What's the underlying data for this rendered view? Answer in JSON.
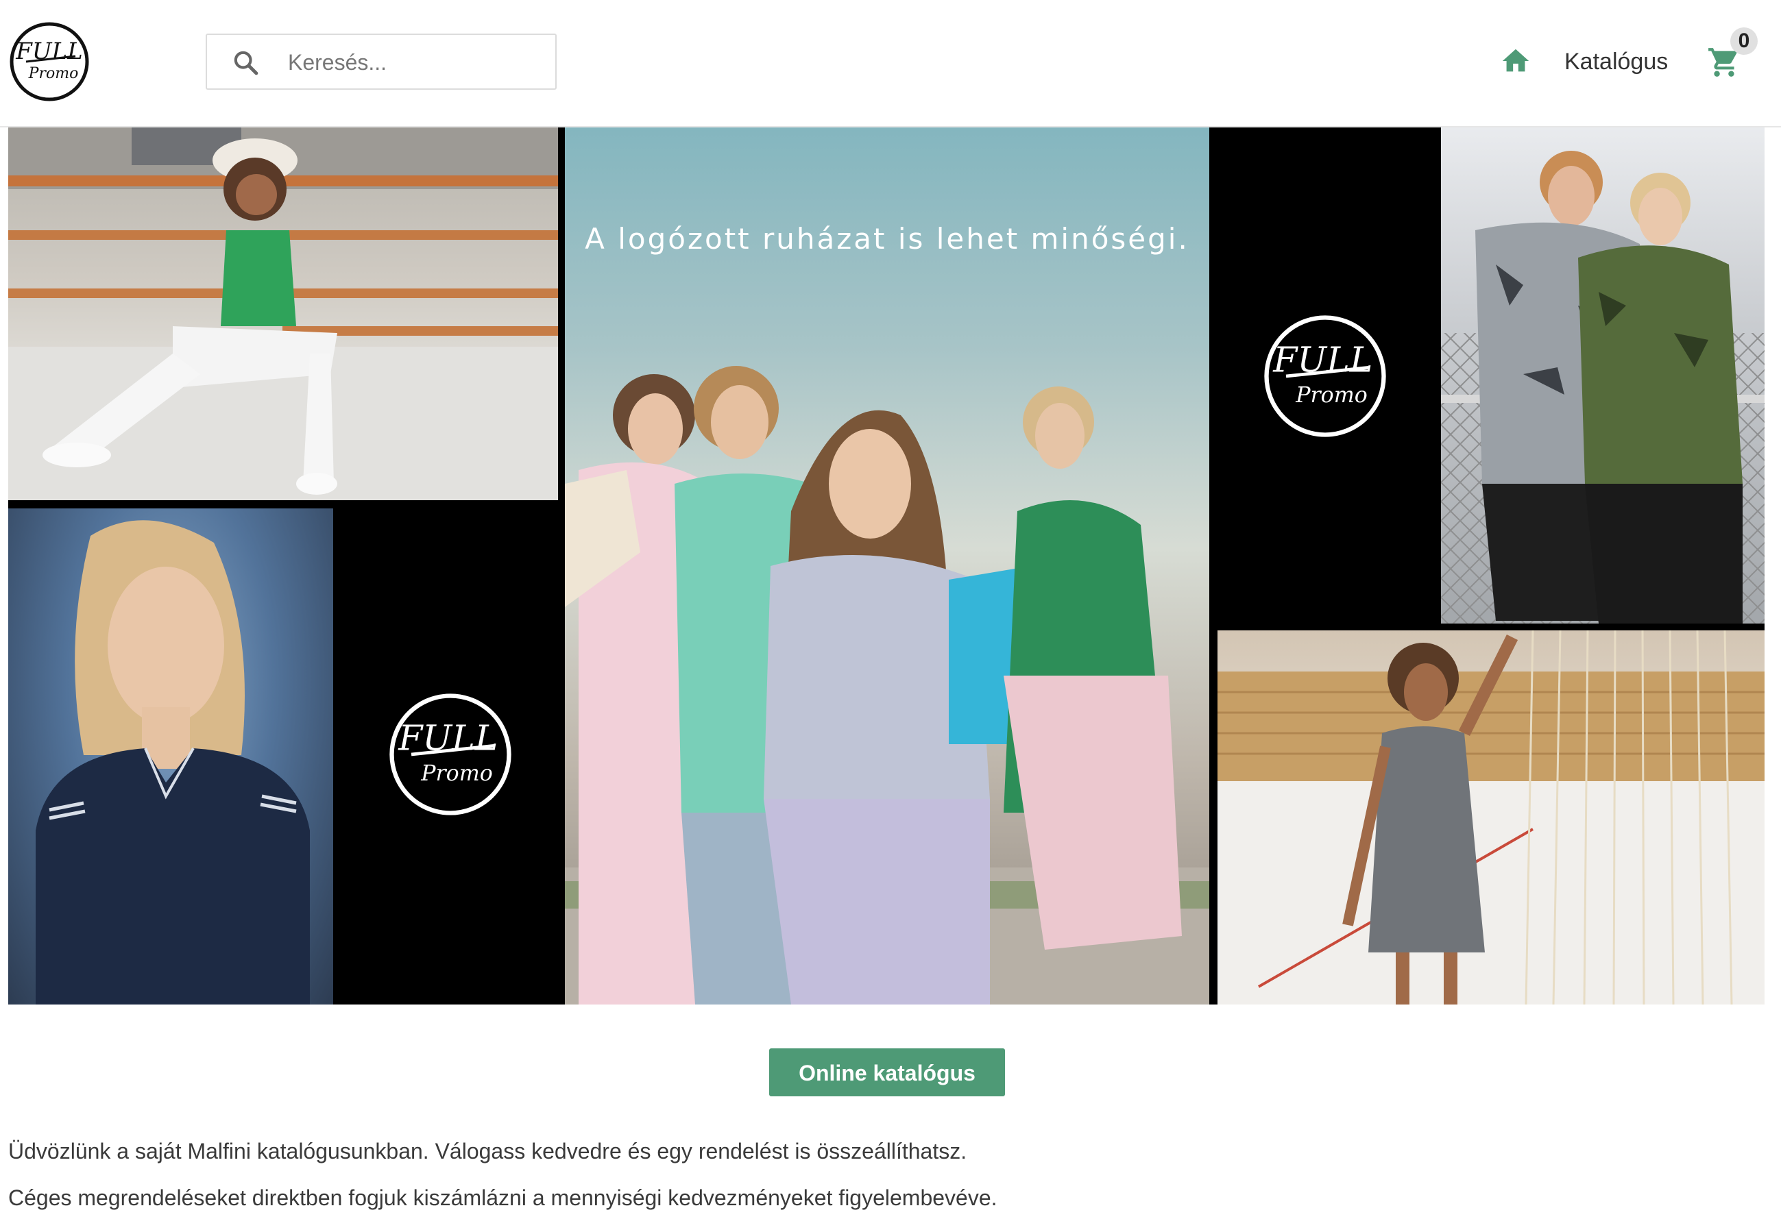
{
  "header": {
    "logo_text_top": "FULL",
    "logo_text_bottom": "Promo",
    "search": {
      "placeholder": "Keresés..."
    },
    "nav": {
      "home_icon": "home-icon",
      "catalog_label": "Katalógus",
      "cart_icon": "shopping-cart-icon",
      "cart_count": "0"
    }
  },
  "hero": {
    "slogan": "A logózott ruházat is lehet minőségi.",
    "logo_text_top": "FULL",
    "logo_text_bottom": "Promo"
  },
  "cta": {
    "label": "Online katalógus"
  },
  "intro": {
    "line1": "Üdvözlünk a saját Malfini katalógusunkban. Válogass kedvedre és egy rendelést is összeállíthatsz.",
    "line2": "Céges megrendeléseket direktben fogjuk kiszámlázni a mennyiségi kedvezményeket figyelembevéve."
  },
  "colors": {
    "accent": "#4e9a76",
    "text": "#333333",
    "border": "#dcdcdc"
  }
}
